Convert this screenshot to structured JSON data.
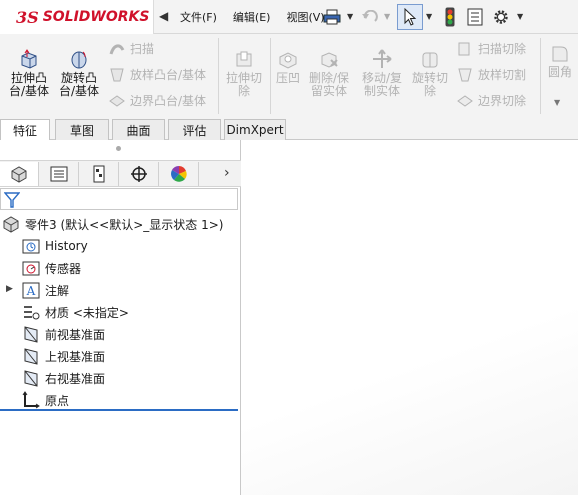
{
  "app": {
    "logo_prefix": "3S",
    "logo_text": "SOLIDWORKS"
  },
  "menu": {
    "items": [
      "文件(F)",
      "编辑(E)",
      "视图(V)"
    ]
  },
  "ribbon": {
    "extrude_boss": "拉伸凸\n台/基体",
    "revolve_boss": "旋转凸\n台/基体",
    "sweep": "扫描",
    "loft": "放样凸台/基体",
    "boundary": "边界凸台/基体",
    "extrude_cut": "拉伸切\n除",
    "indent": "压凹",
    "delete_body": "删除/保\n留实体",
    "move_copy": "移动/复\n制实体",
    "revolve_cut": "旋转切\n除",
    "swept_cut": "扫描切除",
    "lofted_cut": "放样切割",
    "boundary_cut": "边界切除",
    "fillet": "圆角"
  },
  "tabs": [
    "特征",
    "草图",
    "曲面",
    "评估",
    "DimXpert"
  ],
  "tree": {
    "root": "零件3  (默认<<默认>_显示状态 1>)",
    "items": [
      "History",
      "传感器",
      "注解",
      "材质 <未指定>",
      "前视基准面",
      "上视基准面",
      "右视基准面",
      "原点"
    ]
  },
  "colors": {
    "brand": "#d0112b",
    "accent": "#2b6cc4",
    "disabled": "#b3b3b3"
  }
}
